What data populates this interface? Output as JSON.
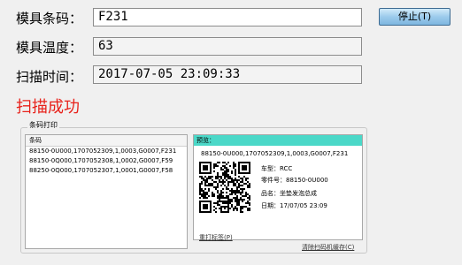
{
  "form": {
    "barcode_label": "模具条码：",
    "barcode_value": "F231",
    "temp_label": "模具温度：",
    "temp_value": "63",
    "scan_time_label": "扫描时间：",
    "scan_time_value": "2017-07-05 23:09:33"
  },
  "stop_button": "停止(T)",
  "status_text": "扫描成功",
  "status_color": "#e8211a",
  "group": {
    "title": "条码打印",
    "list_header": "条码",
    "list_rows": [
      "88150-0U000,1707052309,1,0003,G0007,F231",
      "88150-0Q000,1707052308,1,0002,G0007,F59",
      "88250-0Q000,1707052307,1,0001,G0007,F58"
    ],
    "preview": {
      "header": "预览：",
      "code_line": "88150-0U000,1707052309,1,0003,G0007,F231",
      "car_type": "车型：RCC",
      "part_no": "零件号：88150-0U000",
      "part_name": "品名：坐垫发泡总成",
      "date": "日期：17/07/05 23:09"
    },
    "reprint_link": "重打标签(P)",
    "clear_cache_link": "清除扫码机缓存(C)",
    "preview_header_color": "#4bd8c8"
  }
}
